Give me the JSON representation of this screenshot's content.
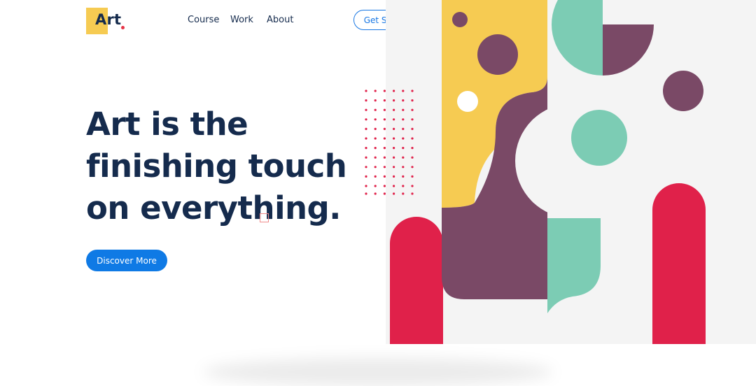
{
  "logo": {
    "text": "Art"
  },
  "nav": {
    "items": [
      "Course",
      "Work",
      "About"
    ]
  },
  "header": {
    "cta_label": "Get Started"
  },
  "hero": {
    "title_lines": [
      "Art is the",
      "finishing touch",
      "on everything."
    ],
    "cta_label": "Discover More"
  },
  "colors": {
    "navy": "#152b4d",
    "blue": "#1877e3",
    "yellow": "#f6cb52",
    "plum": "#7a4966",
    "mint": "#7cccb4",
    "red": "#e0214a",
    "panel": "#f4f4f4"
  }
}
